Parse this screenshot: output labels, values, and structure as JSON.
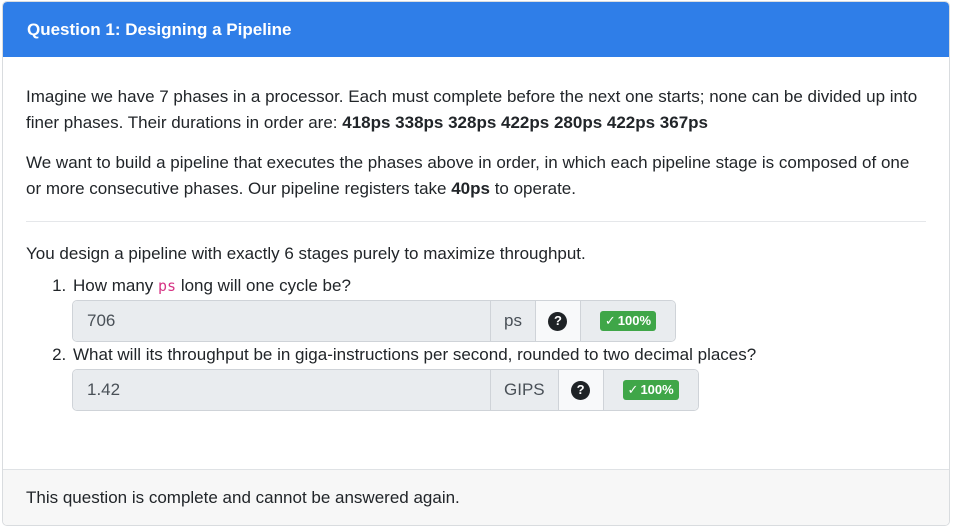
{
  "header": {
    "title": "Question 1: Designing a Pipeline"
  },
  "body": {
    "intro_text": "Imagine we have 7 phases in a processor. Each must complete before the next one starts; none can be divided up into finer phases. Their durations in order are: ",
    "durations": "418ps 338ps 328ps 422ps 280ps 422ps 367ps",
    "pipeline_text_1": "We want to build a pipeline that executes the phases above in order, in which each pipeline stage is composed of one or more consecutive phases. Our pipeline registers take ",
    "register_time": "40ps",
    "pipeline_text_2": " to operate.",
    "design_text": "You design a pipeline with exactly 6 stages purely to maximize throughput."
  },
  "questions": [
    {
      "number": "1.",
      "prefix": "How many ",
      "code": "ps",
      "suffix": " long will one cycle be?",
      "answer": "706",
      "unit": "ps",
      "help": "?",
      "score": "100%"
    },
    {
      "number": "2.",
      "prefix": "What will its throughput be in giga-instructions per second, rounded to two decimal places?",
      "code": "",
      "suffix": "",
      "answer": "1.42",
      "unit": "GIPS",
      "help": "?",
      "score": "100%"
    }
  ],
  "footer": {
    "text": "This question is complete and cannot be answered again."
  },
  "colors": {
    "header": "#2f7ee8",
    "badge": "#3fa648",
    "code": "#d63384"
  }
}
